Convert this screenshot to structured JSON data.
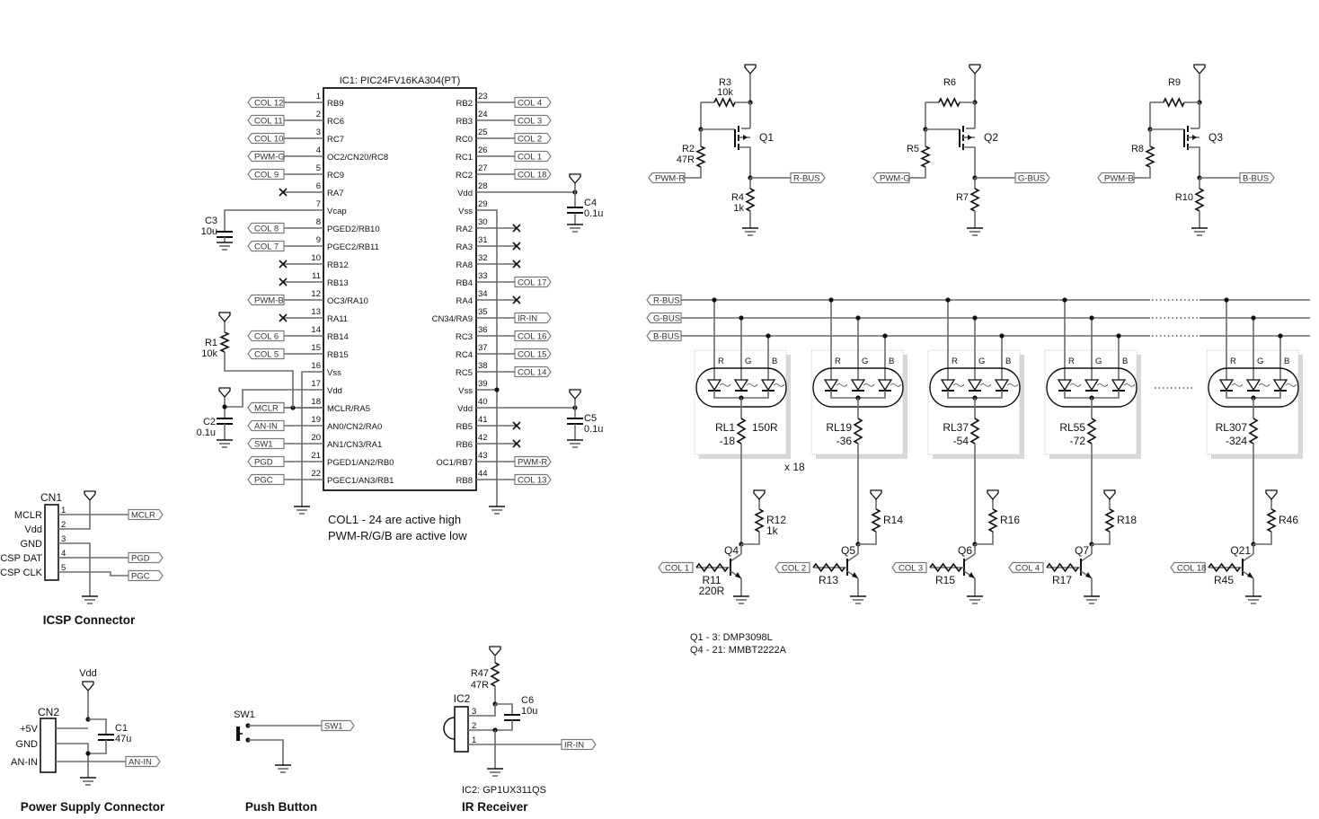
{
  "ic1": {
    "title": "IC1: PIC24FV16KA304(PT)",
    "left_pins": [
      {
        "num": "1",
        "name": "RB9",
        "net": "COL 12"
      },
      {
        "num": "2",
        "name": "RC6",
        "net": "COL 11"
      },
      {
        "num": "3",
        "name": "RC7",
        "net": "COL 10"
      },
      {
        "num": "4",
        "name": "OC2/CN20/RC8",
        "net": "PWM-G"
      },
      {
        "num": "5",
        "name": "RC9",
        "net": "COL 9"
      },
      {
        "num": "6",
        "name": "RA7",
        "net": "NC"
      },
      {
        "num": "7",
        "name": "Vcap",
        "net": "C3"
      },
      {
        "num": "8",
        "name": "PGED2/RB10",
        "net": "COL 8"
      },
      {
        "num": "9",
        "name": "PGEC2/RB11",
        "net": "COL 7"
      },
      {
        "num": "10",
        "name": "RB12",
        "net": "NC"
      },
      {
        "num": "11",
        "name": "RB13",
        "net": "NC"
      },
      {
        "num": "12",
        "name": "OC3/RA10",
        "net": "PWM-B"
      },
      {
        "num": "13",
        "name": "RA11",
        "net": "NC"
      },
      {
        "num": "14",
        "name": "RB14",
        "net": "COL 6"
      },
      {
        "num": "15",
        "name": "RB15",
        "net": "COL 5"
      },
      {
        "num": "16",
        "name": "Vss",
        "net": "GND"
      },
      {
        "num": "17",
        "name": "Vdd",
        "net": "VDD"
      },
      {
        "num": "18",
        "name": "MCLR/RA5",
        "net": "MCLR"
      },
      {
        "num": "19",
        "name": "AN0/CN2/RA0",
        "net": "AN-IN"
      },
      {
        "num": "20",
        "name": "AN1/CN3/RA1",
        "net": "SW1"
      },
      {
        "num": "21",
        "name": "PGED1/AN2/RB0",
        "net": "PGD"
      },
      {
        "num": "22",
        "name": "PGEC1/AN3/RB1",
        "net": "PGC"
      }
    ],
    "right_pins": [
      {
        "num": "23",
        "name": "RB2",
        "net": "COL 4"
      },
      {
        "num": "24",
        "name": "RB3",
        "net": "COL 3"
      },
      {
        "num": "25",
        "name": "RC0",
        "net": "COL 2"
      },
      {
        "num": "26",
        "name": "RC1",
        "net": "COL 1"
      },
      {
        "num": "27",
        "name": "RC2",
        "net": "COL 18"
      },
      {
        "num": "28",
        "name": "Vdd",
        "net": "VDD"
      },
      {
        "num": "29",
        "name": "Vss",
        "net": "GND"
      },
      {
        "num": "30",
        "name": "RA2",
        "net": "NC"
      },
      {
        "num": "31",
        "name": "RA3",
        "net": "NC"
      },
      {
        "num": "32",
        "name": "RA8",
        "net": "NC"
      },
      {
        "num": "33",
        "name": "RB4",
        "net": "COL 17"
      },
      {
        "num": "34",
        "name": "RA4",
        "net": "NC"
      },
      {
        "num": "35",
        "name": "CN34/RA9",
        "net": "IR-IN"
      },
      {
        "num": "36",
        "name": "RC3",
        "net": "COL 16"
      },
      {
        "num": "37",
        "name": "RC4",
        "net": "COL 15"
      },
      {
        "num": "38",
        "name": "RC5",
        "net": "COL 14"
      },
      {
        "num": "39",
        "name": "Vss",
        "net": "GND"
      },
      {
        "num": "40",
        "name": "Vdd",
        "net": "VDD"
      },
      {
        "num": "41",
        "name": "RB5",
        "net": "NC"
      },
      {
        "num": "42",
        "name": "RB6",
        "net": "NC"
      },
      {
        "num": "43",
        "name": "OC1/RB7",
        "net": "PWM-R"
      },
      {
        "num": "44",
        "name": "RB8",
        "net": "COL 13"
      }
    ],
    "c3": {
      "ref": "C3",
      "val": "10u"
    },
    "c4": {
      "ref": "C4",
      "val": "0.1u"
    },
    "c5": {
      "ref": "C5",
      "val": "0.1u"
    },
    "c2": {
      "ref": "C2",
      "val": "0.1u"
    },
    "r1": {
      "ref": "R1",
      "val": "10k"
    },
    "note1": "COL1 - 24 are active high",
    "note2": "PWM-R/G/B are active low"
  },
  "drivers": [
    {
      "q": "Q1",
      "r_top": "R3",
      "r_top_val": "10k",
      "r_gate": "R2",
      "r_gate_val": "47R",
      "r_pd": "R4",
      "r_pd_val": "1k",
      "in": "PWM-R",
      "out": "R-BUS"
    },
    {
      "q": "Q2",
      "r_top": "R6",
      "r_top_val": "",
      "r_gate": "R5",
      "r_gate_val": "",
      "r_pd": "R7",
      "r_pd_val": "",
      "in": "PWM-G",
      "out": "G-BUS"
    },
    {
      "q": "Q3",
      "r_top": "R9",
      "r_top_val": "",
      "r_gate": "R8",
      "r_gate_val": "",
      "r_pd": "R10",
      "r_pd_val": "",
      "in": "PWM-B",
      "out": "B-BUS"
    }
  ],
  "buses": [
    "R-BUS",
    "G-BUS",
    "B-BUS"
  ],
  "led_pin_labels": [
    "R",
    "G",
    "B"
  ],
  "led_groups": [
    {
      "ref": "RL1",
      "range": "-18",
      "val": "150R"
    },
    {
      "ref": "RL19",
      "range": "-36",
      "val": ""
    },
    {
      "ref": "RL37",
      "range": "-54",
      "val": ""
    },
    {
      "ref": "RL55",
      "range": "-72",
      "val": ""
    },
    {
      "ref": "RL307",
      "range": "-324",
      "val": ""
    }
  ],
  "multiplier": "x 18",
  "columns": [
    {
      "q": "Q4",
      "rb": "R11",
      "rb_val": "220R",
      "rc": "R12",
      "rc_val": "1k",
      "in": "COL 1"
    },
    {
      "q": "Q5",
      "rb": "R13",
      "rb_val": "",
      "rc": "R14",
      "rc_val": "",
      "in": "COL 2"
    },
    {
      "q": "Q6",
      "rb": "R15",
      "rb_val": "",
      "rc": "R16",
      "rc_val": "",
      "in": "COL 3"
    },
    {
      "q": "Q7",
      "rb": "R17",
      "rb_val": "",
      "rc": "R18",
      "rc_val": "",
      "in": "COL 4"
    },
    {
      "q": "Q21",
      "rb": "R45",
      "rb_val": "",
      "rc": "R46",
      "rc_val": "",
      "in": "COL 18"
    }
  ],
  "parts_note": [
    "Q1 - 3: DMP3098L",
    "Q4 - 21: MMBT2222A"
  ],
  "icsp": {
    "ref": "CN1",
    "pins": [
      {
        "num": "1",
        "name": "MCLR",
        "net": "MCLR"
      },
      {
        "num": "2",
        "name": "Vdd",
        "net": ""
      },
      {
        "num": "3",
        "name": "GND",
        "net": ""
      },
      {
        "num": "4",
        "name": "ICSP DAT",
        "net": "PGD"
      },
      {
        "num": "5",
        "name": "ICSP CLK",
        "net": "PGC"
      }
    ],
    "caption": "ICSP Connector"
  },
  "power": {
    "ref": "CN2",
    "pins": [
      "+5V",
      "GND",
      "AN-IN"
    ],
    "vdd_label": "Vdd",
    "cap_ref": "C1",
    "cap_val": "47u",
    "net": "AN-IN",
    "caption": "Power Supply Connector"
  },
  "button": {
    "ref": "SW1",
    "net": "SW1",
    "caption": "Push Button"
  },
  "ir": {
    "ref": "IC2",
    "r_ref": "R47",
    "r_val": "47R",
    "c_ref": "C6",
    "c_val": "10u",
    "pins": [
      "3",
      "2",
      "1"
    ],
    "net": "IR-IN",
    "part": "IC2: GP1UX311QS",
    "caption": "IR Receiver"
  }
}
